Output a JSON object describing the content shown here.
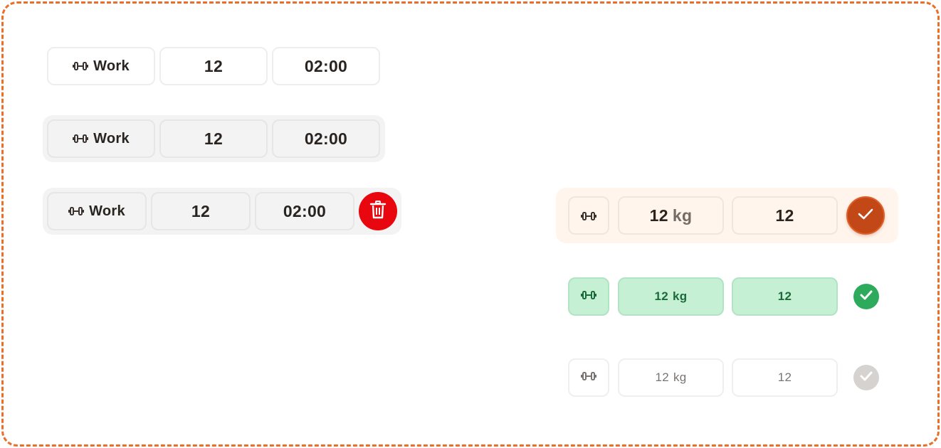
{
  "row_work_plain": {
    "icon": "dumbbell-icon",
    "label": "Work",
    "reps": "12",
    "time": "02:00"
  },
  "row_work_grouped": {
    "icon": "dumbbell-icon",
    "label": "Work",
    "reps": "12",
    "time": "02:00"
  },
  "row_work_deletable": {
    "icon": "dumbbell-icon",
    "label": "Work",
    "reps": "12",
    "time": "02:00",
    "delete_icon": "trash-icon"
  },
  "set_active": {
    "icon": "dumbbell-icon",
    "weight": "12",
    "unit": "kg",
    "reps": "12",
    "check_icon": "check-icon",
    "accent": "#c24818"
  },
  "set_done": {
    "icon": "dumbbell-icon",
    "weight": "12",
    "unit": "kg",
    "reps": "12",
    "check_icon": "check-circle-icon",
    "accent": "#2eaa5c"
  },
  "set_pending": {
    "icon": "dumbbell-icon",
    "weight": "12",
    "unit": "kg",
    "reps": "12",
    "check_icon": "check-circle-icon",
    "accent": "#d5d2d0"
  },
  "colors": {
    "frame_border": "#e8702a",
    "delete": "#e8070f"
  }
}
